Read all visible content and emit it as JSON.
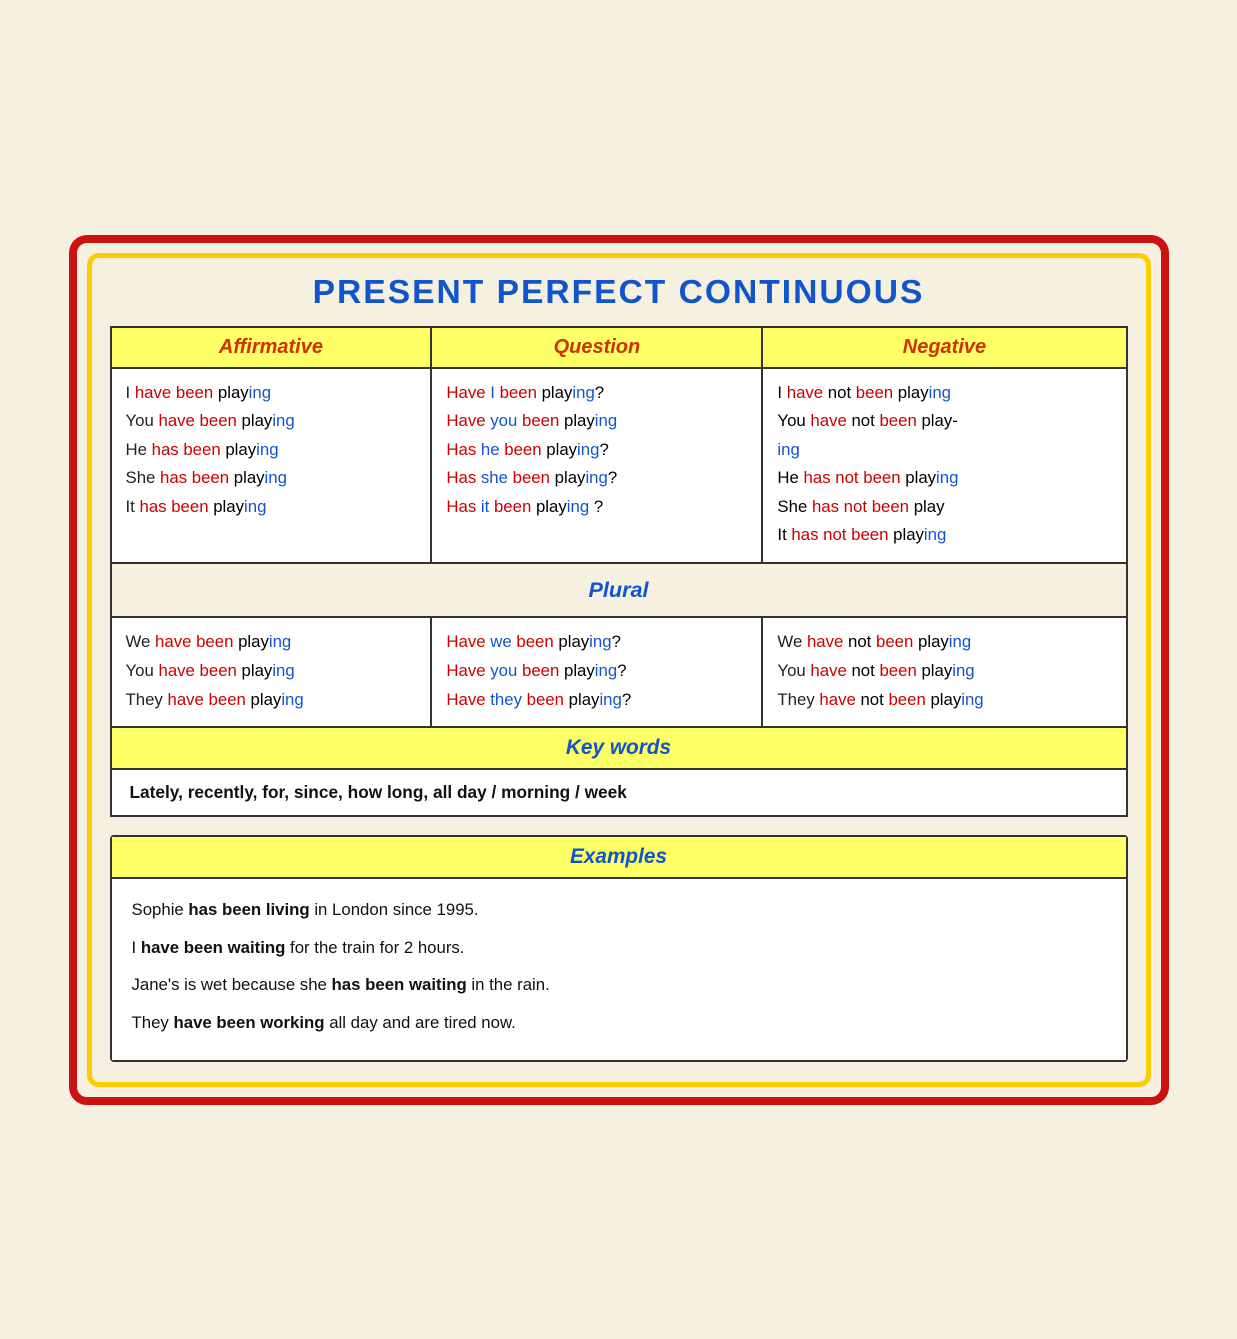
{
  "title": "PRESENT PERFECT CONTINUOUS",
  "headers": {
    "affirmative": "Affirmative",
    "question": "Question",
    "negative": "Negative"
  },
  "singular": {
    "affirmative": [
      {
        "subject": "I",
        "aux": "have been",
        "verb": "play",
        "ending": "ing"
      },
      {
        "subject": "You",
        "aux": "have been",
        "verb": "play",
        "ending": "ing"
      },
      {
        "subject": "He",
        "aux": "has been",
        "verb": "play",
        "ending": "ing"
      },
      {
        "subject": "She",
        "aux": "has been",
        "verb": "play",
        "ending": "ing"
      },
      {
        "subject": "It",
        "aux": "has been",
        "verb": "play",
        "ending": "ing"
      }
    ],
    "question": [
      {
        "aux1": "Have",
        "subject": "I",
        "aux2": "been",
        "verb": "playing",
        "mark": "?"
      },
      {
        "aux1": "Have",
        "subject": "you",
        "aux2": "been",
        "verb": "playing",
        "mark": ""
      },
      {
        "aux1": "Has",
        "subject": "he",
        "aux2": "been",
        "verb": "playing",
        "mark": "?"
      },
      {
        "aux1": "Has",
        "subject": "she",
        "aux2": "been",
        "verb": "playing",
        "mark": "?"
      },
      {
        "aux1": "Has",
        "subject": "it",
        "aux2": "been",
        "verb": "playing",
        "mark": "?"
      }
    ],
    "negative": [
      {
        "subject": "I",
        "aux": "have not been",
        "verb": "play",
        "ending": "ing"
      },
      {
        "subject": "You",
        "aux": "have not been",
        "verb": "play-ing",
        "ending": ""
      },
      {
        "subject": "He",
        "aux": "has not been",
        "verb": "play",
        "ending": "ing"
      },
      {
        "subject": "She",
        "aux": "has not been",
        "verb": "play",
        "ending": ""
      },
      {
        "subject": "It",
        "aux": "has not been",
        "verb": "play",
        "ending": "ing"
      }
    ]
  },
  "plural_label": "Plural",
  "plural": {
    "affirmative": [
      {
        "subject": "We",
        "aux": "have been",
        "verb": "play",
        "ending": "ing"
      },
      {
        "subject": "You",
        "aux": "have been",
        "verb": "play",
        "ending": "ing"
      },
      {
        "subject": "They",
        "aux": "have been",
        "verb": "play",
        "ending": "ing"
      }
    ],
    "question": [
      {
        "aux1": "Have",
        "subject": "we",
        "aux2": "been",
        "verb": "playing",
        "mark": "?"
      },
      {
        "aux1": "Have",
        "subject": "you",
        "aux2": "been",
        "verb": "playing",
        "mark": "?"
      },
      {
        "aux1": "Have",
        "subject": "they",
        "aux2": "been",
        "verb": "playing",
        "mark": "?"
      }
    ],
    "negative": [
      {
        "subject": "We",
        "aux": "have not been",
        "verb": "play",
        "ending": "ing"
      },
      {
        "subject": "You",
        "aux": "have not been",
        "verb": "play",
        "ending": "ing"
      },
      {
        "subject": "They",
        "aux": "have not been",
        "verb": "play",
        "ending": "ing"
      }
    ]
  },
  "keywords": {
    "label": "Key words",
    "content": "Lately, recently, for, since, how long, all day / morning / week"
  },
  "examples": {
    "label": "Examples",
    "items": [
      {
        "before": "Sophie ",
        "bold": "has been living",
        "after": " in London since 1995."
      },
      {
        "before": "I ",
        "bold": "have been waiting",
        "after": " for the train for 2 hours."
      },
      {
        "before": "Jane’s is wet because she ",
        "bold": "has been waiting",
        "after": " in the rain."
      },
      {
        "before": "They ",
        "bold": "have been working",
        "after": " all day and are tired now."
      }
    ]
  }
}
